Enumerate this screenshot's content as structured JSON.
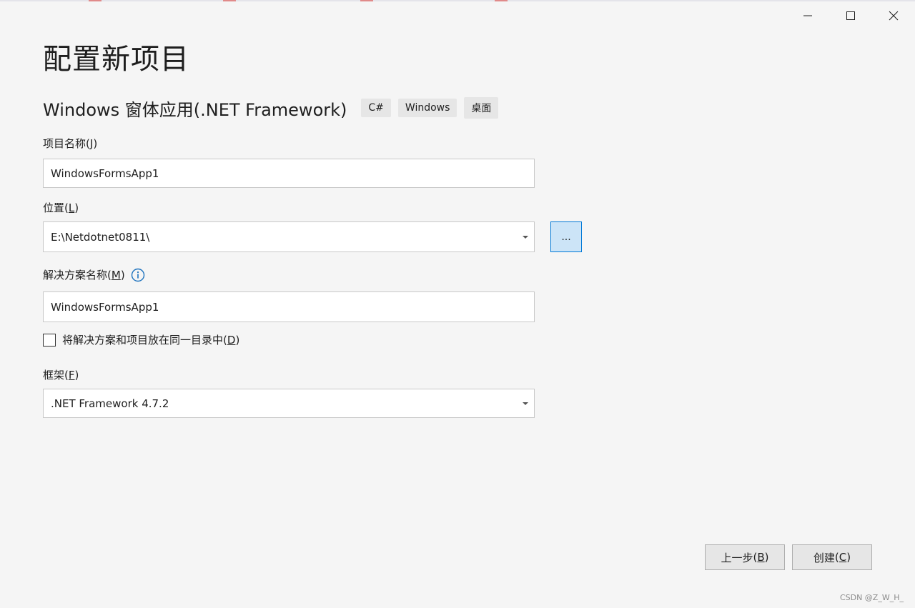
{
  "dialog": {
    "title": "配置新项目",
    "template_name": "Windows 窗体应用(.NET Framework)",
    "tags": [
      "C#",
      "Windows",
      "桌面"
    ]
  },
  "project_name": {
    "label": "项目名称",
    "access_key": "J",
    "value": "WindowsFormsApp1"
  },
  "location": {
    "label": "位置",
    "access_key": "L",
    "value": "E:\\Netdotnet0811\\",
    "browse_label": "..."
  },
  "solution_name": {
    "label": "解决方案名称",
    "access_key": "M",
    "value": "WindowsFormsApp1"
  },
  "same_dir": {
    "label": "将解决方案和项目放在同一目录中",
    "access_key": "D",
    "checked": false
  },
  "framework": {
    "label": "框架",
    "access_key": "F",
    "value": ".NET Framework 4.7.2"
  },
  "footer": {
    "back_label": "上一步",
    "back_key": "B",
    "create_label": "创建",
    "create_key": "C"
  },
  "watermark": "CSDN @Z_W_H_",
  "colors": {
    "background": "#f5f5f5",
    "accent": "#0078d7",
    "browse_bg": "#cce4f7",
    "info_icon": "#1e73be"
  },
  "icons": {
    "minimize": "minimize-icon",
    "maximize": "maximize-icon",
    "close": "close-icon",
    "info": "info-icon",
    "dropdown": "chevron-down-icon"
  }
}
